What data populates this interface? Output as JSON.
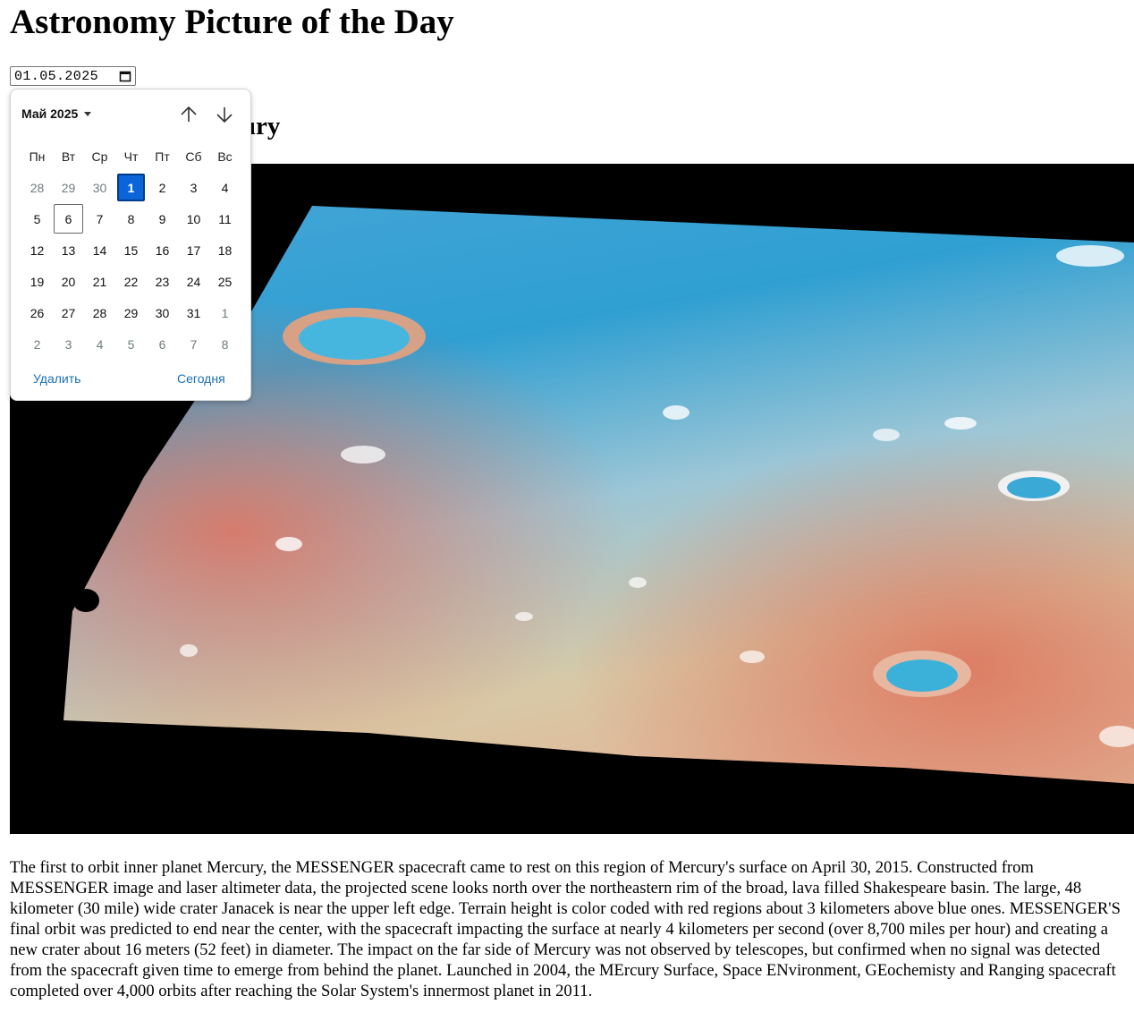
{
  "page": {
    "heading": "Astronomy Picture of the Day",
    "date_value": "01.05.2025",
    "picture_title": "A Final Day on Mercury",
    "explanation": "The first to orbit inner planet Mercury, the MESSENGER spacecraft came to rest on this region of Mercury's surface on April 30, 2015. Constructed from MESSENGER image and laser altimeter data, the projected scene looks north over the northeastern rim of the broad, lava filled Shakespeare basin. The large, 48 kilometer (30 mile) wide crater Janacek is near the upper left edge. Terrain height is color coded with red regions about 3 kilometers above blue ones. MESSENGER'S final orbit was predicted to end near the center, with the spacecraft impacting the surface at nearly 4 kilometers per second (over 8,700 miles per hour) and creating a new crater about 16 meters (52 feet) in diameter. The impact on the far side of Mercury was not observed by telescopes, but confirmed when no signal was detected from the spacecraft given time to emerge from behind the planet. Launched in 2004, the MErcury Surface, Space ENvironment, GEochemisty and Ranging spacecraft completed over 4,000 orbits after reaching the Solar System's innermost planet in 2011."
  },
  "picker": {
    "month_label": "Май 2025",
    "weekdays": [
      "Пн",
      "Вт",
      "Ср",
      "Чт",
      "Пт",
      "Сб",
      "Вс"
    ],
    "weeks": [
      [
        "28",
        "29",
        "30",
        "1",
        "2",
        "3",
        "4"
      ],
      [
        "5",
        "6",
        "7",
        "8",
        "9",
        "10",
        "11"
      ],
      [
        "12",
        "13",
        "14",
        "15",
        "16",
        "17",
        "18"
      ],
      [
        "19",
        "20",
        "21",
        "22",
        "23",
        "24",
        "25"
      ],
      [
        "26",
        "27",
        "28",
        "29",
        "30",
        "31",
        "1"
      ],
      [
        "2",
        "3",
        "4",
        "5",
        "6",
        "7",
        "8"
      ]
    ],
    "clear_label": "Удалить",
    "today_label": "Сегодня"
  },
  "icons": {
    "date_input": "calendar-icon",
    "nav_prev": "arrow-up-icon",
    "nav_next": "arrow-down-icon",
    "month_menu": "caret-down-icon"
  },
  "colors": {
    "selected_day": "#0a66d8",
    "link": "#1a6fb5"
  }
}
